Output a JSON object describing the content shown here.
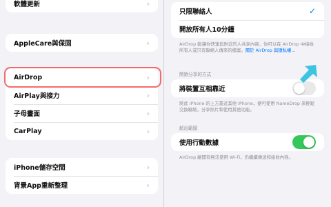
{
  "left_pane": {
    "items": [
      {
        "label": "軟體更新"
      },
      {
        "label": "AppleCare與保固"
      },
      {
        "label": "AirDrop"
      },
      {
        "label": "AirPlay與接力"
      },
      {
        "label": "子母畫面"
      },
      {
        "label": "CarPlay"
      },
      {
        "label": "iPhone儲存空間"
      },
      {
        "label": "背景App重新整理"
      }
    ],
    "highlighted_item": "AirDrop"
  },
  "right_pane": {
    "receiving": {
      "options": [
        {
          "label": "只限聯絡人",
          "selected": true
        },
        {
          "label": "開放所有人10分鐘",
          "selected": false
        }
      ],
      "note": "AirDrop 能讓你快速與附近的人共享內容，你可以在 AirDrop 中接收所有人或只有聯絡人傳來的檔案。",
      "note_link": "關於 AirDrop 與隱私權..."
    },
    "start_sharing": {
      "header": "開始分享的方式",
      "label": "將裝置互相靠近",
      "toggle_on": false,
      "note": "將此 iPhone 的上方靠近其他 iPhone，便可使用 NameDrop 來輕鬆交換聯絡，分享照片和使用其他功能。"
    },
    "out_of_range": {
      "header": "超出範圍",
      "label": "使用行動數據",
      "toggle_on": true,
      "note": "AirDrop 離開有無法使用 Wi-Fi，仍繼續傳送和接收內容。"
    }
  },
  "annotation": {
    "arrow_color": "#3cc4e0",
    "highlight_color": "#f26b6b"
  },
  "icons": {
    "chevron": "›",
    "check": "✓"
  }
}
